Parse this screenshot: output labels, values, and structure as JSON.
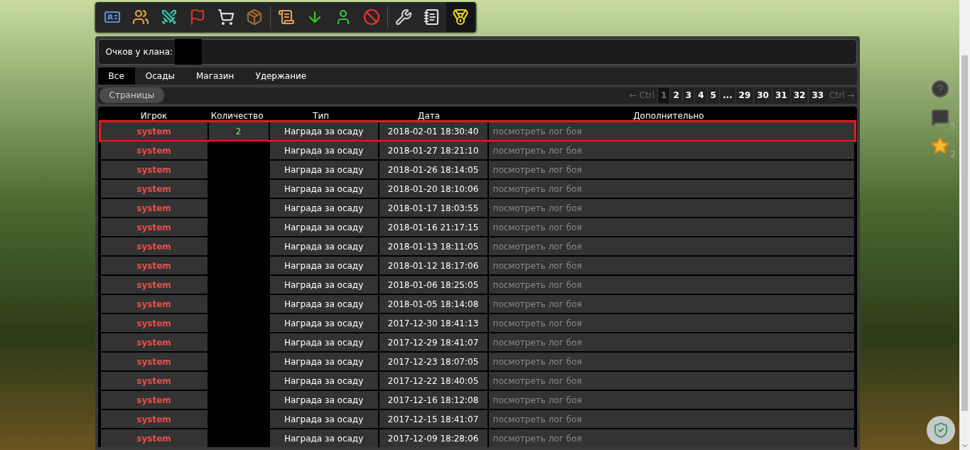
{
  "toolbar": {
    "groups": [
      [
        {
          "selected": false
        },
        {
          "selected": false
        },
        {
          "selected": false
        },
        {
          "selected": false
        },
        {
          "selected": false
        },
        {
          "selected": false
        }
      ],
      [
        {
          "selected": false
        },
        {
          "selected": false
        },
        {
          "selected": false
        },
        {
          "selected": false
        }
      ],
      [
        {
          "selected": false
        },
        {
          "selected": false
        },
        {
          "selected": true
        }
      ]
    ]
  },
  "clan_points": {
    "label": "Очков у клана:"
  },
  "tabs": [
    {
      "label": "Все",
      "selected": true
    },
    {
      "label": "Осады",
      "selected": false
    },
    {
      "label": "Магазин",
      "selected": false
    },
    {
      "label": "Удержание",
      "selected": false
    }
  ],
  "pages": {
    "label": "Страницы",
    "prev": "← Ctrl",
    "next": "Ctrl →",
    "items": [
      {
        "label": "1",
        "selected": true
      },
      {
        "label": "2",
        "selected": false
      },
      {
        "label": "3",
        "selected": false
      },
      {
        "label": "4",
        "selected": false
      },
      {
        "label": "5",
        "selected": false
      },
      {
        "label": "...",
        "selected": false
      },
      {
        "label": "29",
        "selected": false
      },
      {
        "label": "30",
        "selected": false
      },
      {
        "label": "31",
        "selected": false
      },
      {
        "label": "32",
        "selected": false
      },
      {
        "label": "33",
        "selected": false
      }
    ]
  },
  "table": {
    "columns": [
      "Игрок",
      "Количество",
      "Тип",
      "Дата",
      "Дополнительно"
    ],
    "rows": [
      {
        "player": "system",
        "quantity": "2",
        "type": "Награда за осаду",
        "date": "2018-02-01 18:30:40",
        "extra": "посмотреть лог боя",
        "highlighted": true
      },
      {
        "player": "system",
        "type": "Награда за осаду",
        "date": "2018-01-27 18:21:10",
        "extra": "посмотреть лог боя",
        "highlighted": false
      },
      {
        "player": "system",
        "type": "Награда за осаду",
        "date": "2018-01-26 18:14:05",
        "extra": "посмотреть лог боя",
        "highlighted": false
      },
      {
        "player": "system",
        "type": "Награда за осаду",
        "date": "2018-01-20 18:10:06",
        "extra": "посмотреть лог боя",
        "highlighted": false
      },
      {
        "player": "system",
        "type": "Награда за осаду",
        "date": "2018-01-17 18:03:55",
        "extra": "посмотреть лог боя",
        "highlighted": false
      },
      {
        "player": "system",
        "type": "Награда за осаду",
        "date": "2018-01-16 21:17:15",
        "extra": "посмотреть лог боя",
        "highlighted": false
      },
      {
        "player": "system",
        "type": "Награда за осаду",
        "date": "2018-01-13 18:11:05",
        "extra": "посмотреть лог боя",
        "highlighted": false
      },
      {
        "player": "system",
        "type": "Награда за осаду",
        "date": "2018-01-12 18:17:06",
        "extra": "посмотреть лог боя",
        "highlighted": false
      },
      {
        "player": "system",
        "type": "Награда за осаду",
        "date": "2018-01-06 18:25:05",
        "extra": "посмотреть лог боя",
        "highlighted": false
      },
      {
        "player": "system",
        "type": "Награда за осаду",
        "date": "2018-01-05 18:14:08",
        "extra": "посмотреть лог боя",
        "highlighted": false
      },
      {
        "player": "system",
        "type": "Награда за осаду",
        "date": "2017-12-30 18:41:13",
        "extra": "посмотреть лог боя",
        "highlighted": false
      },
      {
        "player": "system",
        "type": "Награда за осаду",
        "date": "2017-12-29 18:41:07",
        "extra": "посмотреть лог боя",
        "highlighted": false
      },
      {
        "player": "system",
        "type": "Награда за осаду",
        "date": "2017-12-23 18:07:05",
        "extra": "посмотреть лог боя",
        "highlighted": false
      },
      {
        "player": "system",
        "type": "Награда за осаду",
        "date": "2017-12-22 18:40:05",
        "extra": "посмотреть лог боя",
        "highlighted": false
      },
      {
        "player": "system",
        "type": "Награда за осаду",
        "date": "2017-12-16 18:12:08",
        "extra": "посмотреть лог боя",
        "highlighted": false
      },
      {
        "player": "system",
        "type": "Награда за осаду",
        "date": "2017-12-15 18:41:07",
        "extra": "посмотреть лог боя",
        "highlighted": false
      },
      {
        "player": "system",
        "type": "Награда за осаду",
        "date": "2017-12-09 18:28:06",
        "extra": "посмотреть лог боя",
        "highlighted": false
      }
    ]
  },
  "side": {
    "messages": "5",
    "favorites": "2"
  }
}
